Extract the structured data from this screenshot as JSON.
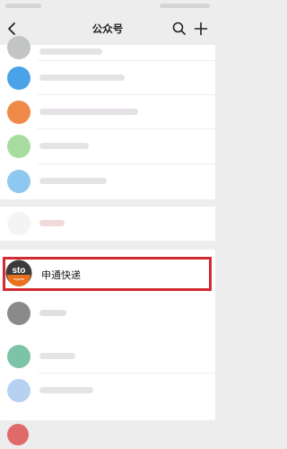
{
  "nav": {
    "title": "公众号",
    "back_icon": "chevron-left-icon",
    "search_icon": "search-icon",
    "add_icon": "plus-icon"
  },
  "highlighted_item": {
    "label": "申通快递",
    "avatar_text": "sto",
    "avatar_subtext": "express",
    "highlight_color": "#d42a34"
  },
  "colors": {
    "background": "#ededed",
    "list_background": "#ffffff",
    "sto_orange": "#e8721c",
    "sto_dark": "#3a3a3a"
  }
}
